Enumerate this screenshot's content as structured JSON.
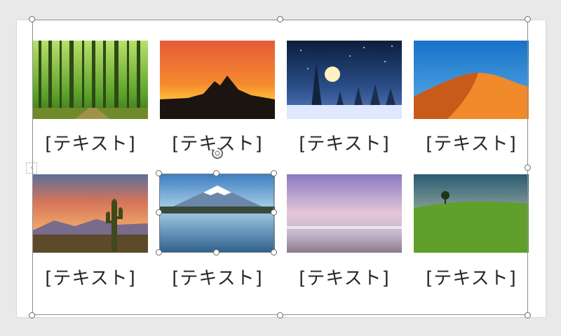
{
  "slide": {
    "images": [
      {
        "subject": "green forest"
      },
      {
        "subject": "mountain sunset silhouette"
      },
      {
        "subject": "snowy night with full moon"
      },
      {
        "subject": "orange desert dune"
      },
      {
        "subject": "cactus at sunset"
      },
      {
        "subject": "Mount Fuji lake reflection"
      },
      {
        "subject": "pastel beach seascape"
      },
      {
        "subject": "tree on green hill"
      }
    ],
    "captions": [
      "[テキスト]",
      "[テキスト]",
      "[テキスト]",
      "[テキスト]",
      "[テキスト]",
      "[テキスト]",
      "[テキスト]",
      "[テキスト]"
    ]
  },
  "ui": {
    "collapse_tab_glyph": "‹",
    "selected_image_index": 5,
    "selection_color": "#7a7a7a"
  }
}
